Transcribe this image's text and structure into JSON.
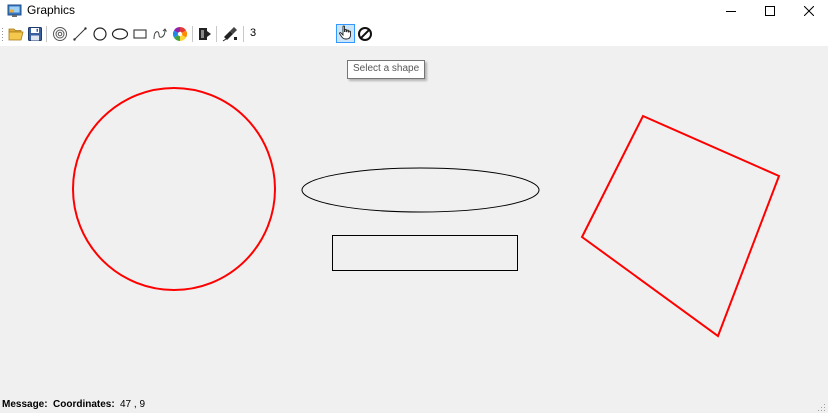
{
  "window": {
    "title": "Graphics",
    "controls": [
      "minimize-icon",
      "maximize-icon",
      "close-icon"
    ]
  },
  "toolbar": {
    "buttons": [
      {
        "name": "open",
        "icon": "folder-open-icon"
      },
      {
        "name": "save",
        "icon": "floppy-disk-icon"
      },
      {
        "name": "concentric-circles",
        "icon": "concentric-circles-icon"
      },
      {
        "name": "line",
        "icon": "line-icon"
      },
      {
        "name": "circle",
        "icon": "circle-icon"
      },
      {
        "name": "ellipse",
        "icon": "ellipse-icon"
      },
      {
        "name": "rectangle",
        "icon": "rectangle-icon"
      },
      {
        "name": "curve",
        "icon": "curve-icon"
      },
      {
        "name": "color",
        "icon": "color-wheel-icon"
      },
      {
        "name": "fill",
        "icon": "fill-icon"
      },
      {
        "name": "brush",
        "icon": "brush-icon"
      },
      {
        "name": "select",
        "icon": "hand-pointer-icon",
        "active": true
      },
      {
        "name": "cancel",
        "icon": "no-entry-icon"
      }
    ],
    "width_value": "3"
  },
  "tooltip": {
    "text": "Select a shape"
  },
  "canvas": {
    "background": "#f0f0f0",
    "shapes": [
      {
        "type": "circle",
        "stroke": "#ff0000"
      },
      {
        "type": "ellipse",
        "stroke": "#000000"
      },
      {
        "type": "rectangle",
        "stroke": "#000000"
      },
      {
        "type": "polygon",
        "stroke": "#ff0000"
      }
    ]
  },
  "status": {
    "message_label": "Message:",
    "message_value": "",
    "coordinates_label": "Coordinates:",
    "coordinates_value": "47 , 9"
  },
  "colors": {
    "accent_selected": "#cce4f7",
    "accent_border": "#3399ff",
    "shape_red": "#ff0000"
  }
}
